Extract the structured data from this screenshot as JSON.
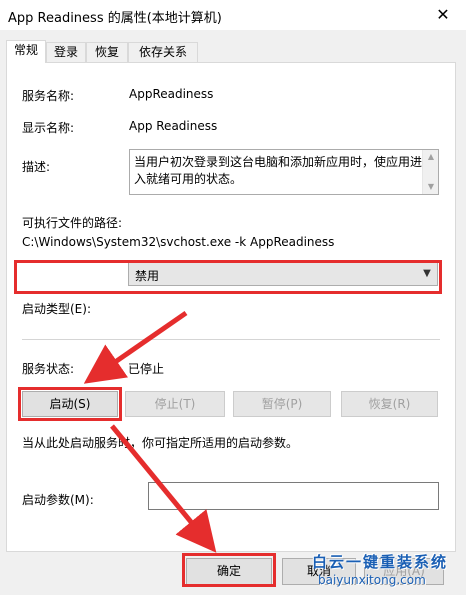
{
  "window": {
    "title": "App Readiness 的属性(本地计算机)",
    "close_glyph": "✕"
  },
  "tabs": [
    {
      "label": "常规",
      "active": true
    },
    {
      "label": "登录",
      "active": false
    },
    {
      "label": "恢复",
      "active": false
    },
    {
      "label": "依存关系",
      "active": false
    }
  ],
  "general": {
    "service_name_label": "服务名称:",
    "service_name": "AppReadiness",
    "display_name_label": "显示名称:",
    "display_name": "App Readiness",
    "description_label": "描述:",
    "description": "当用户初次登录到这台电脑和添加新应用时，使应用进入就绪可用的状态。",
    "exe_path_label": "可执行文件的路径:",
    "exe_path": "C:\\Windows\\System32\\svchost.exe -k AppReadiness",
    "startup_type_label": "启动类型(E):",
    "startup_type_value": "禁用",
    "service_status_label": "服务状态:",
    "service_status": "已停止",
    "buttons": {
      "start": "启动(S)",
      "stop": "停止(T)",
      "pause": "暂停(P)",
      "resume": "恢复(R)"
    },
    "hint": "当从此处启动服务时，你可指定所适用的启动参数。",
    "start_params_label": "启动参数(M):",
    "start_params_value": ""
  },
  "footer": {
    "ok": "确定",
    "cancel": "取消",
    "apply": "应用(A)"
  },
  "watermark": {
    "title": "白云一键重装系统",
    "url": "baiyunxitong.com"
  },
  "colors": {
    "highlight": "#e52d2d",
    "watermark": "#1a5fb4"
  },
  "icons": {
    "close": "close-icon",
    "dropdown": "chevron-down-icon",
    "scroll_up": "scroll-up-icon",
    "scroll_down": "scroll-down-icon"
  }
}
